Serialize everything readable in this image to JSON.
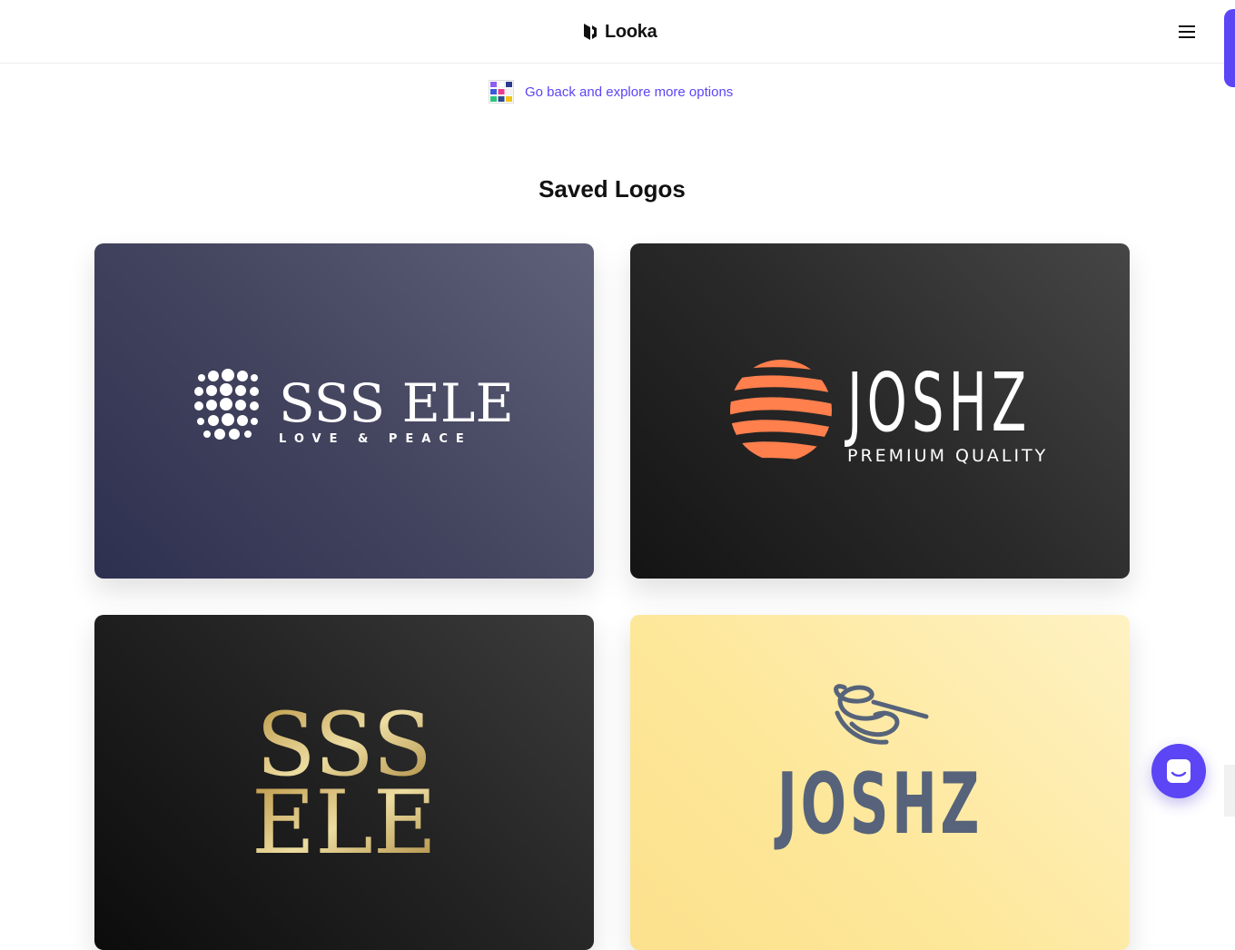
{
  "brand": {
    "name": "Looka"
  },
  "nav": {
    "back_link_text": "Go back and explore more options"
  },
  "main": {
    "title": "Saved Logos",
    "logos": [
      {
        "name": "SSS ELE",
        "tagline": "LOVE & PEACE",
        "text_color": "#ffffff"
      },
      {
        "name": "JOSHZ",
        "tagline": "PREMIUM QUALITY",
        "text_color": "#ffffff",
        "accent": "#ff7f4d"
      },
      {
        "name_line1": "SSS",
        "name_line2": "ELE",
        "text_color": "#d2b86a"
      },
      {
        "name": "JOSHZ",
        "text_color": "#56637a"
      }
    ]
  },
  "colors": {
    "accent": "#5b45f5",
    "text": "#111111"
  }
}
